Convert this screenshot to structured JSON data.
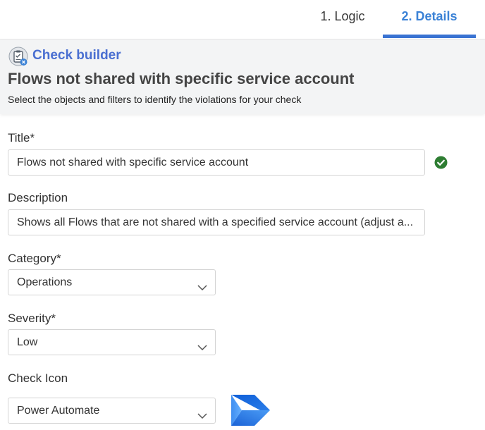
{
  "tabs": [
    {
      "label": "1. Logic",
      "active": false
    },
    {
      "label": "2. Details",
      "active": true
    }
  ],
  "header": {
    "builder_label": "Check builder",
    "title": "Flows not shared with specific service account",
    "subtitle": "Select the objects and filters to identify the violations for your check"
  },
  "form": {
    "title_label": "Title*",
    "title_value": "Flows not shared with specific service account",
    "description_label": "Description",
    "description_value": "Shows all Flows that are not shared with a specified service account (adjust a...",
    "category_label": "Category*",
    "category_value": "Operations",
    "severity_label": "Severity*",
    "severity_value": "Low",
    "icon_label": "Check Icon",
    "icon_value": "Power Automate"
  },
  "colors": {
    "accent": "#3a73d2",
    "valid": "#2e7d32",
    "header_bg": "#f3f4f5"
  },
  "icons": {
    "builder": "checklist-clipboard-icon",
    "valid": "checkmark-circle-icon",
    "chevron": "chevron-down-icon",
    "check_icon_preview": "power-automate-icon"
  }
}
